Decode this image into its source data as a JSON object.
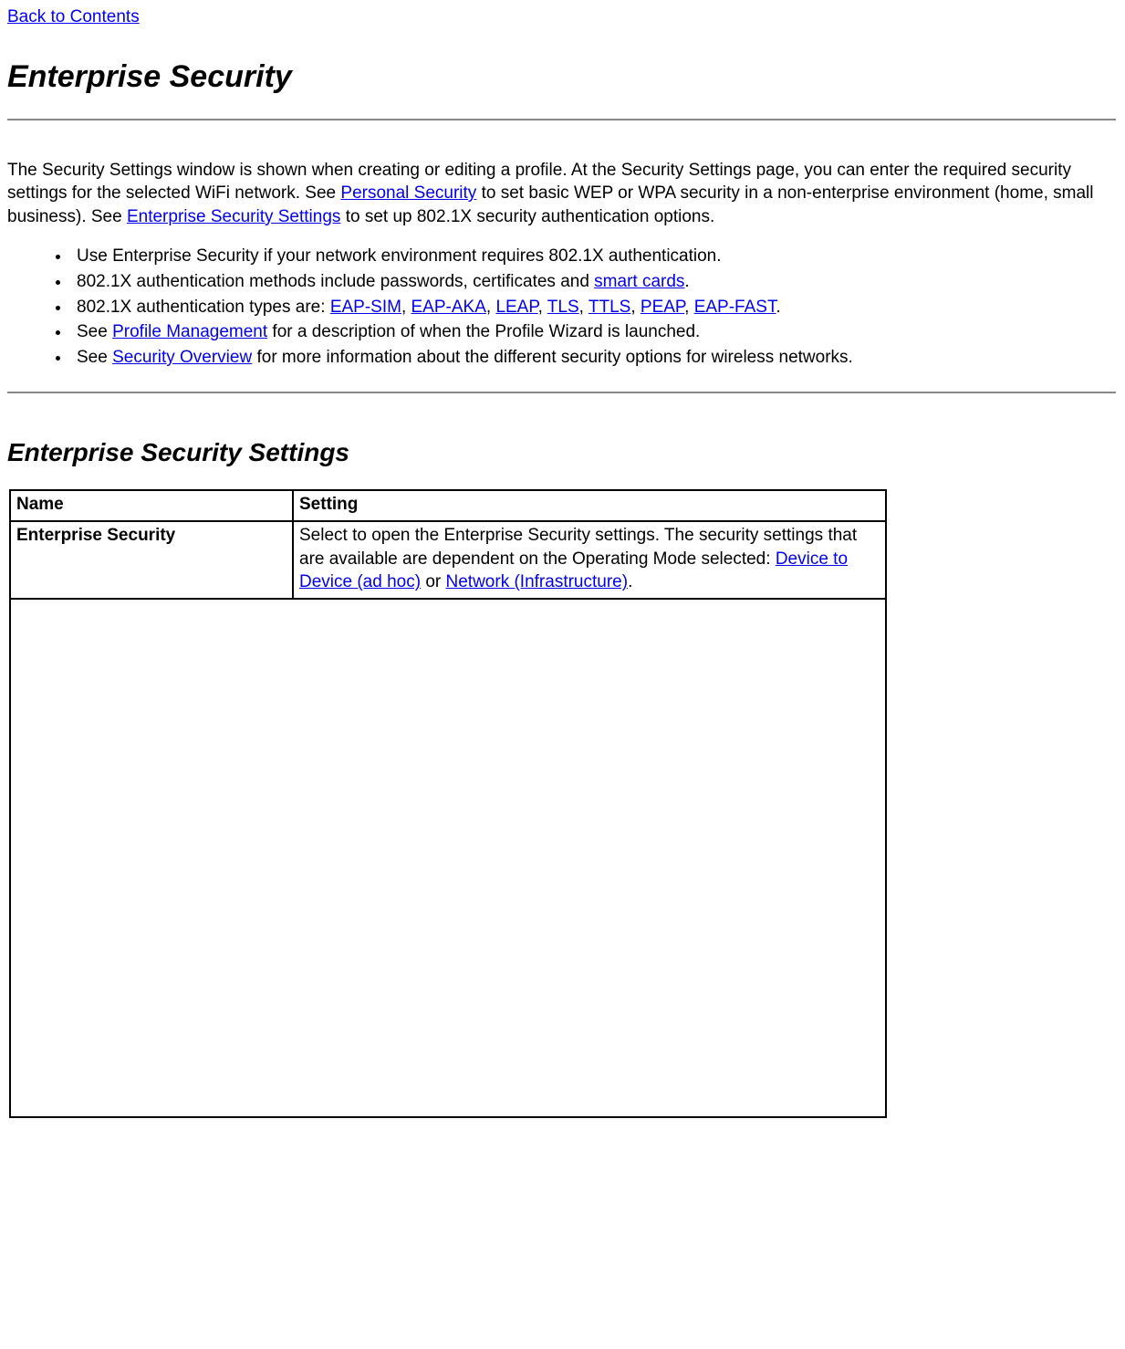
{
  "nav": {
    "back": "Back to Contents"
  },
  "h1": "Enterprise Security",
  "intro": {
    "p1a": "The Security Settings window is shown when creating or editing a profile. At the Security Settings page, you can enter the required security settings for the selected WiFi network. See ",
    "link_personal": "Personal Security",
    "p1b": " to set basic WEP or WPA security in a non-enterprise environment (home, small business). See ",
    "link_ess": "Enterprise Security Settings",
    "p1c": " to set up 802.1X security authentication options."
  },
  "bullets": {
    "b1": "Use Enterprise Security if your network environment requires 802.1X authentication.",
    "b2a": "802.1X authentication methods include passwords, certificates and ",
    "b2_link": "smart cards",
    "b2b": ".",
    "b3a": "802.1X authentication types are: ",
    "eapsim": "EAP-SIM",
    "eapaka": "EAP-AKA",
    "leap": "LEAP",
    "tls": "TLS",
    "ttls": "TTLS",
    "peap": "PEAP",
    "eapfast": "EAP-FAST",
    "sep": ", ",
    "b3b": ".",
    "b4a": "See ",
    "b4_link": "Profile Management",
    "b4b": " for a description of when the Profile Wizard is launched.",
    "b5a": "See ",
    "b5_link": "Security Overview",
    "b5b": " for more information about the different security options for wireless networks."
  },
  "h2": "Enterprise Security Settings",
  "table": {
    "head_name": "Name",
    "head_setting": "Setting",
    "row1_name": "Enterprise Security",
    "row1_a": "Select to open the Enterprise Security settings. The security settings that are available are dependent on the Operating Mode selected: ",
    "row1_link1": "Device to Device (ad hoc)",
    "row1_mid": " or ",
    "row1_link2": "Network (Infrastructure)",
    "row1_end": "."
  }
}
